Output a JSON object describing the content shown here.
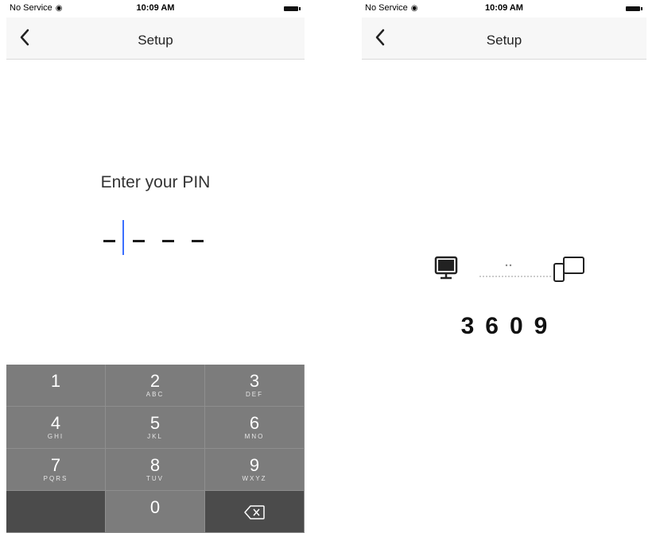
{
  "left_screen": {
    "status": {
      "carrier": "No Service",
      "time": "10:09 AM"
    },
    "nav": {
      "title": "Setup"
    },
    "prompt": "Enter your PIN",
    "pin_dashes": [
      "-",
      "-",
      "-",
      "-"
    ],
    "keypad": [
      {
        "num": "1",
        "letters": ""
      },
      {
        "num": "2",
        "letters": "ABC"
      },
      {
        "num": "3",
        "letters": "DEF"
      },
      {
        "num": "4",
        "letters": "GHI"
      },
      {
        "num": "5",
        "letters": "JKL"
      },
      {
        "num": "6",
        "letters": "MNO"
      },
      {
        "num": "7",
        "letters": "PQRS"
      },
      {
        "num": "8",
        "letters": "TUV"
      },
      {
        "num": "9",
        "letters": "WXYZ"
      },
      {
        "num": "0",
        "letters": ""
      }
    ]
  },
  "right_screen": {
    "status": {
      "carrier": "No Service",
      "time": "10:09 AM"
    },
    "nav": {
      "title": "Setup"
    },
    "code": "3609"
  },
  "colors": {
    "caret": "#3b6fff",
    "keypad_bg": "#7c7c7c",
    "keypad_dark": "#4b4b4b"
  }
}
